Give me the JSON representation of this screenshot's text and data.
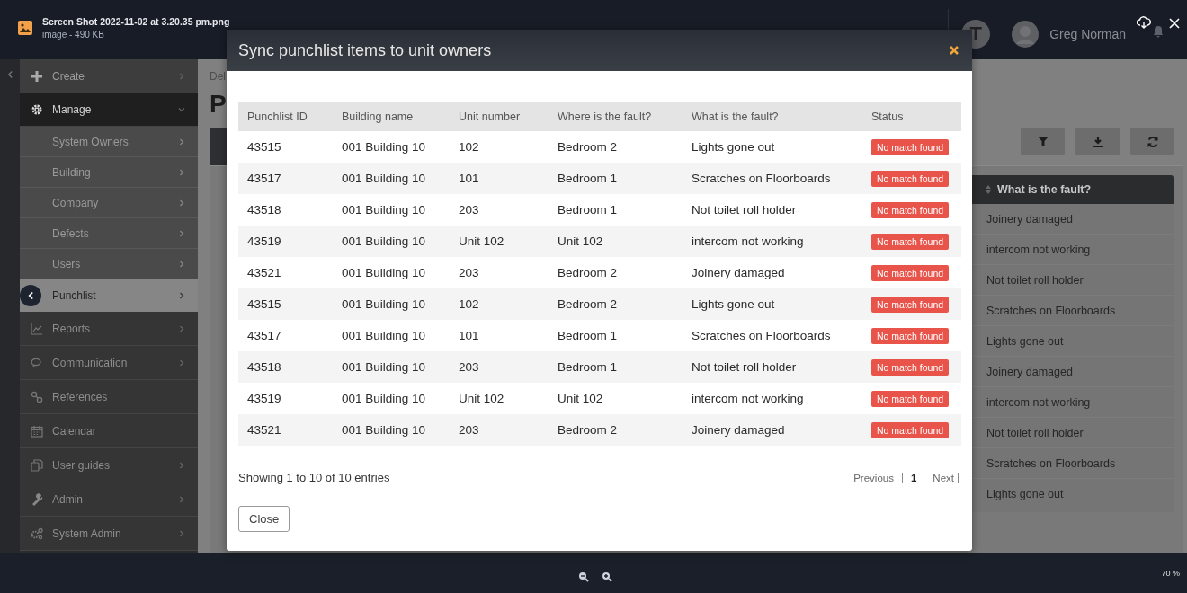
{
  "viewer": {
    "file_name": "Screen Shot 2022-11-02 at 3.20.35 pm.png",
    "file_info": "image - 490 KB",
    "zoom": "70 %"
  },
  "header": {
    "avatar_letter": "T",
    "user_name": "Greg Norman"
  },
  "sidebar": {
    "items": [
      {
        "label": "Create",
        "kind": "menu",
        "selected": false,
        "expanded": false
      },
      {
        "label": "Manage",
        "kind": "menu",
        "selected": false,
        "expanded": true,
        "children": [
          {
            "label": "System Owners",
            "selected": false
          },
          {
            "label": "Building",
            "selected": false
          },
          {
            "label": "Company",
            "selected": false
          },
          {
            "label": "Defects",
            "selected": false
          },
          {
            "label": "Users",
            "selected": false
          },
          {
            "label": "Punchlist",
            "selected": true
          }
        ]
      },
      {
        "label": "Reports",
        "kind": "menu",
        "selected": false,
        "expanded": false
      },
      {
        "label": "Communication",
        "kind": "menu",
        "selected": false,
        "expanded": false
      },
      {
        "label": "References",
        "kind": "link",
        "selected": false,
        "expanded": false
      },
      {
        "label": "Calendar",
        "kind": "link",
        "selected": false,
        "expanded": false
      },
      {
        "label": "User guides",
        "kind": "menu",
        "selected": false,
        "expanded": false
      },
      {
        "label": "Admin",
        "kind": "menu",
        "selected": false,
        "expanded": false
      },
      {
        "label": "System Admin",
        "kind": "menu",
        "selected": false,
        "expanded": false
      }
    ]
  },
  "page": {
    "breadcrumb": "Del",
    "heading": "P",
    "table": {
      "column": "What is the fault?",
      "rows": [
        "Joinery damaged",
        "intercom not working",
        "Not toilet roll holder",
        "Scratches on Floorboards",
        "Lights gone out",
        "Joinery damaged",
        "intercom not working",
        "Not toilet roll holder",
        "Scratches on Floorboards",
        "Lights gone out"
      ]
    }
  },
  "modal": {
    "title": "Sync punchlist items to unit owners",
    "columns": [
      "Punchlist ID",
      "Building name",
      "Unit number",
      "Where is the fault?",
      "What is the fault?",
      "Status"
    ],
    "rows": [
      [
        "43515",
        "001 Building 10",
        "102",
        "Bedroom 2",
        "Lights gone out",
        "No match found"
      ],
      [
        "43517",
        "001 Building 10",
        "101",
        "Bedroom 1",
        "Scratches on Floorboards",
        "No match found"
      ],
      [
        "43518",
        "001 Building 10",
        "203",
        "Bedroom 1",
        "Not toilet roll holder",
        "No match found"
      ],
      [
        "43519",
        "001 Building 10",
        "Unit 102",
        "Unit 102",
        "intercom not working",
        "No match found"
      ],
      [
        "43521",
        "001 Building 10",
        "203",
        "Bedroom 2",
        "Joinery damaged",
        "No match found"
      ],
      [
        "43515",
        "001 Building 10",
        "102",
        "Bedroom 2",
        "Lights gone out",
        "No match found"
      ],
      [
        "43517",
        "001 Building 10",
        "101",
        "Bedroom 1",
        "Scratches on Floorboards",
        "No match found"
      ],
      [
        "43518",
        "001 Building 10",
        "203",
        "Bedroom 1",
        "Not toilet roll holder",
        "No match found"
      ],
      [
        "43519",
        "001 Building 10",
        "Unit 102",
        "Unit 102",
        "intercom not working",
        "No match found"
      ],
      [
        "43521",
        "001 Building 10",
        "203",
        "Bedroom 2",
        "Joinery damaged",
        "No match found"
      ]
    ],
    "info": "Showing 1 to 10 of 10 entries",
    "pagination": [
      {
        "label": "Previous",
        "kind": "prev",
        "selected": false
      },
      {
        "label": "1",
        "kind": "page",
        "selected": true
      },
      {
        "label": "Next",
        "kind": "next",
        "selected": false
      }
    ],
    "close_button": "Close"
  }
}
